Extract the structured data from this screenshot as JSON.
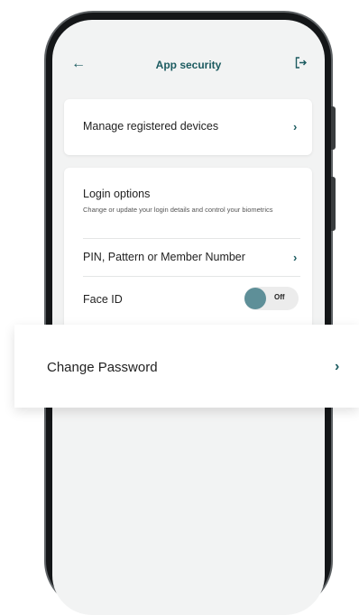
{
  "header": {
    "back_icon": "arrow-left-icon",
    "title": "App security",
    "logout_icon": "logout-icon"
  },
  "devices_card": {
    "label": "Manage registered devices",
    "chevron": "chevron-right-icon"
  },
  "login_options": {
    "title": "Login options",
    "subtitle": "Change or update your login details and control your biometrics",
    "pin_label": "PIN, Pattern or Member Number",
    "face_id_label": "Face ID",
    "face_id_toggle_text": "Off",
    "face_id_enabled": false
  },
  "change_password": {
    "label": "Change Password"
  },
  "colors": {
    "accent": "#1c5b60",
    "toggle_knob": "#5e8f98",
    "screen_bg": "#f2f3f3"
  }
}
